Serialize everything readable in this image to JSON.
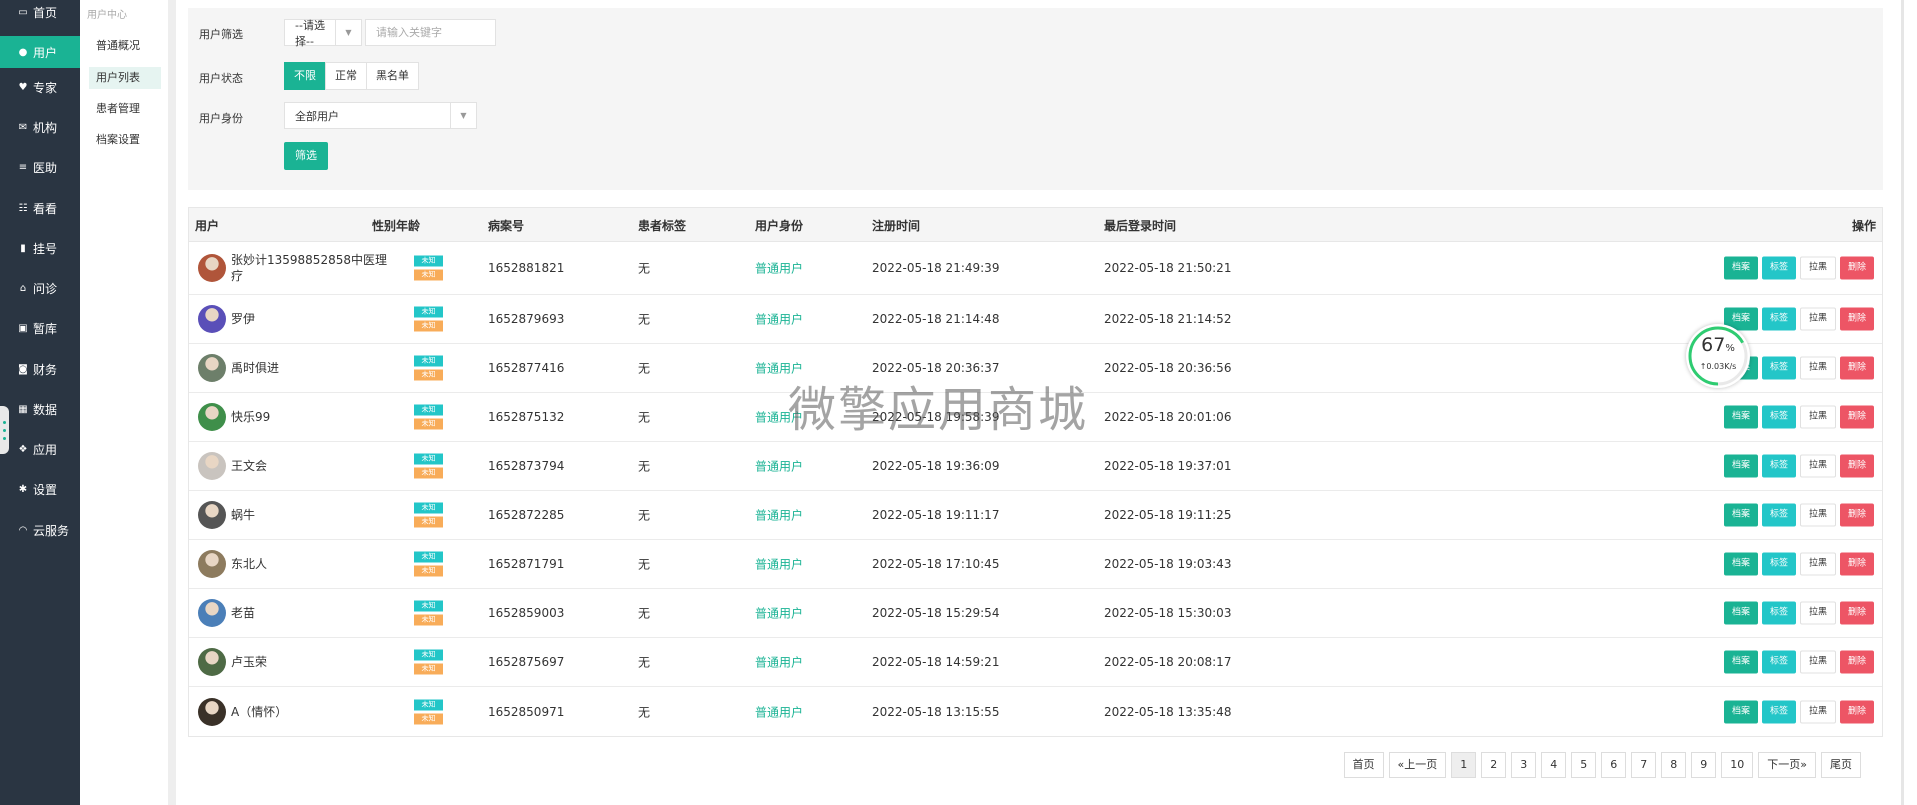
{
  "nav": {
    "items": [
      {
        "label": "首页",
        "icon": "monitor-icon",
        "glyph": "▭",
        "active": false
      },
      {
        "label": "用户",
        "icon": "user-icon",
        "glyph": "●",
        "active": true
      },
      {
        "label": "专家",
        "icon": "heart-icon",
        "glyph": "♥",
        "active": false
      },
      {
        "label": "机构",
        "icon": "mail-icon",
        "glyph": "✉",
        "active": false
      },
      {
        "label": "医助",
        "icon": "list-icon",
        "glyph": "≡",
        "active": false
      },
      {
        "label": "看看",
        "icon": "grid-list-icon",
        "glyph": "☷",
        "active": false
      },
      {
        "label": "挂号",
        "icon": "signal-icon",
        "glyph": "▮",
        "active": false
      },
      {
        "label": "问诊",
        "icon": "home-icon",
        "glyph": "⌂",
        "active": false
      },
      {
        "label": "暂库",
        "icon": "lock-icon",
        "glyph": "▣",
        "active": false
      },
      {
        "label": "财务",
        "icon": "money-icon",
        "glyph": "◙",
        "active": false
      },
      {
        "label": "数据",
        "icon": "table-icon",
        "glyph": "▦",
        "active": false
      },
      {
        "label": "应用",
        "icon": "cubes-icon",
        "glyph": "❖",
        "active": false
      },
      {
        "label": "设置",
        "icon": "gear-icon",
        "glyph": "✱",
        "active": false
      },
      {
        "label": "云服务",
        "icon": "headset-icon",
        "glyph": "◠",
        "active": false
      }
    ]
  },
  "subnav": {
    "title": "用户中心",
    "items": [
      {
        "label": "普通概况",
        "active": false
      },
      {
        "label": "用户列表",
        "active": true
      },
      {
        "label": "患者管理",
        "active": false
      },
      {
        "label": "档案设置",
        "active": false
      }
    ]
  },
  "filters": {
    "user_filter_label": "用户筛选",
    "user_filter_select": "--请选择--",
    "keyword_placeholder": "请输入关键字",
    "status_label": "用户状态",
    "status_options": [
      "不限",
      "正常",
      "黑名单"
    ],
    "status_selected": "不限",
    "identity_label": "用户身份",
    "identity_select": "全部用户",
    "submit_label": "筛选"
  },
  "table": {
    "headers": {
      "user": "用户",
      "gender_age": "性别年龄",
      "record_no": "病案号",
      "patient_tag": "患者标签",
      "identity": "用户身份",
      "register_time": "注册时间",
      "last_login": "最后登录时间",
      "actions": "操作"
    },
    "tag_labels": [
      "未知",
      "未知"
    ],
    "action_labels": {
      "archive": "档案",
      "tag": "标签",
      "block": "拉黑",
      "delete": "删除"
    },
    "rows": [
      {
        "name": "张妙计13598852858中医理疗",
        "record_no": "1652881821",
        "patient_tag": "无",
        "identity": "普通用户",
        "register_time": "2022-05-18 21:49:39",
        "last_login": "2022-05-18 21:50:21",
        "avatar_color": "#b0553a"
      },
      {
        "name": "罗伊",
        "record_no": "1652879693",
        "patient_tag": "无",
        "identity": "普通用户",
        "register_time": "2022-05-18 21:14:48",
        "last_login": "2022-05-18 21:14:52",
        "avatar_color": "#5a4fb8"
      },
      {
        "name": "禹时俱进",
        "record_no": "1652877416",
        "patient_tag": "无",
        "identity": "普通用户",
        "register_time": "2022-05-18 20:36:37",
        "last_login": "2022-05-18 20:36:56",
        "avatar_color": "#6d7f6a"
      },
      {
        "name": "快乐99",
        "record_no": "1652875132",
        "patient_tag": "无",
        "identity": "普通用户",
        "register_time": "2022-05-18 19:58:39",
        "last_login": "2022-05-18 20:01:06",
        "avatar_color": "#3f8f4a"
      },
      {
        "name": "王文会",
        "record_no": "1652873794",
        "patient_tag": "无",
        "identity": "普通用户",
        "register_time": "2022-05-18 19:36:09",
        "last_login": "2022-05-18 19:37:01",
        "avatar_color": "#c9c4bf"
      },
      {
        "name": "蜗牛",
        "record_no": "1652872285",
        "patient_tag": "无",
        "identity": "普通用户",
        "register_time": "2022-05-18 19:11:17",
        "last_login": "2022-05-18 19:11:25",
        "avatar_color": "#555555"
      },
      {
        "name": "东北人",
        "record_no": "1652871791",
        "patient_tag": "无",
        "identity": "普通用户",
        "register_time": "2022-05-18 17:10:45",
        "last_login": "2022-05-18 19:03:43",
        "avatar_color": "#8d7b5e"
      },
      {
        "name": "老苗",
        "record_no": "1652859003",
        "patient_tag": "无",
        "identity": "普通用户",
        "register_time": "2022-05-18 15:29:54",
        "last_login": "2022-05-18 15:30:03",
        "avatar_color": "#4b7fb8"
      },
      {
        "name": "卢玉荣",
        "record_no": "1652875697",
        "patient_tag": "无",
        "identity": "普通用户",
        "register_time": "2022-05-18 14:59:21",
        "last_login": "2022-05-18 20:08:17",
        "avatar_color": "#4e6a45"
      },
      {
        "name": "A（情怀）",
        "record_no": "1652850971",
        "patient_tag": "无",
        "identity": "普通用户",
        "register_time": "2022-05-18 13:15:55",
        "last_login": "2022-05-18 13:35:48",
        "avatar_color": "#3a3128"
      }
    ]
  },
  "pager": {
    "first": "首页",
    "prev": "«上一页",
    "pages": [
      "1",
      "2",
      "3",
      "4",
      "5",
      "6",
      "7",
      "8",
      "9",
      "10"
    ],
    "current": "1",
    "next": "下一页»",
    "last": "尾页"
  },
  "watermark": "微擎应用商城",
  "speed_widget": {
    "percent": "67",
    "percent_unit": "%",
    "percent_value": 0.67,
    "rate": "↑0.03K/s",
    "accent": "#2ecc71"
  },
  "colors": {
    "primary": "#1ab394",
    "info": "#23c6c8",
    "warning": "#f8ac59",
    "danger": "#ed5565",
    "nav_bg": "#2a3542"
  }
}
